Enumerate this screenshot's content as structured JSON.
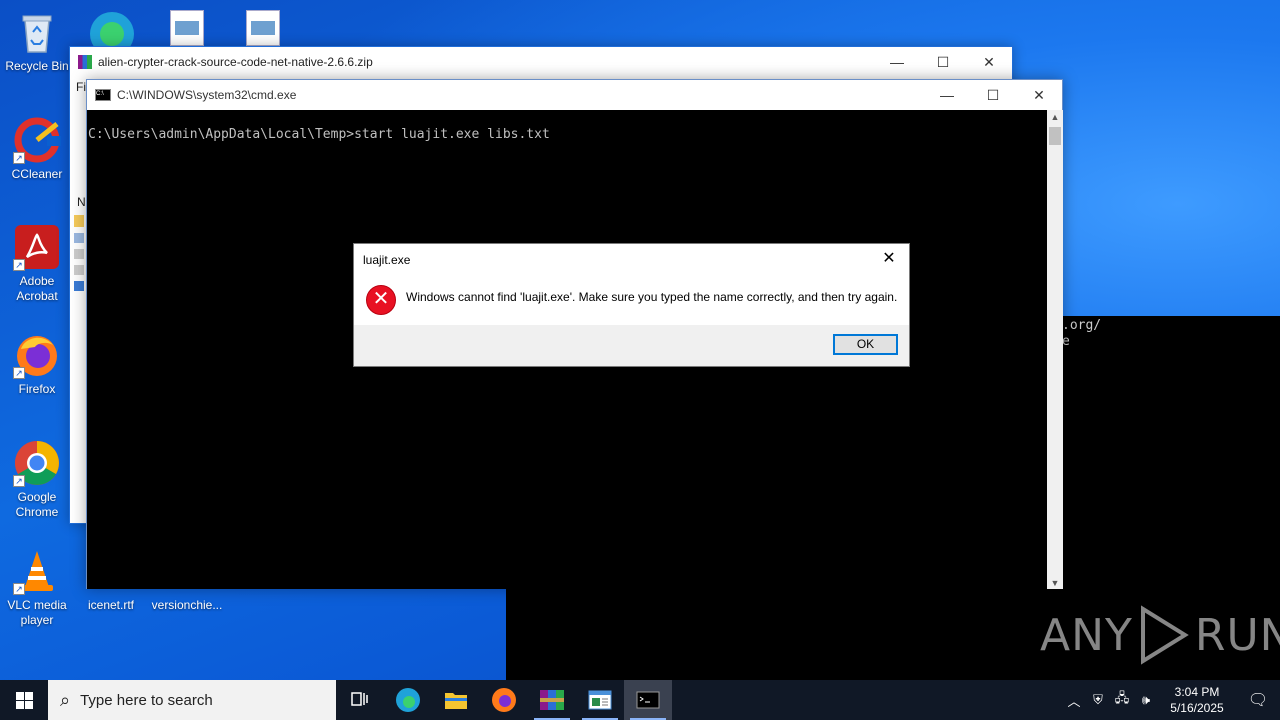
{
  "desktop": {
    "icons": [
      {
        "label": "Recycle Bin"
      },
      {
        "label": "CCleaner"
      },
      {
        "label": "Adobe Acrobat"
      },
      {
        "label": "Firefox"
      },
      {
        "label": "Google Chrome"
      },
      {
        "label": "VLC media player"
      },
      {
        "label": "icenet.rtf"
      },
      {
        "label": "versionchie..."
      }
    ]
  },
  "winrar_window": {
    "title": "alien-crypter-crack-source-code-net-native-2.6.6.zip",
    "menu_stub": "Fi",
    "col_stub": "N"
  },
  "background_console": {
    "line1": ".org/",
    "line2": "e"
  },
  "cmd_window": {
    "title": "C:\\WINDOWS\\system32\\cmd.exe",
    "prompt_line": "C:\\Users\\admin\\AppData\\Local\\Temp>start luajit.exe libs.txt"
  },
  "dialog": {
    "title": "luajit.exe",
    "message": "Windows cannot find 'luajit.exe'. Make sure you typed the name correctly, and then try again.",
    "ok_label": "OK"
  },
  "taskbar": {
    "search_placeholder": "Type here to search",
    "time": "3:04 PM",
    "date": "5/16/2025"
  },
  "watermark": {
    "left": "ANY",
    "right": "RUN"
  },
  "colors": {
    "error_red": "#e81123",
    "accent_blue": "#0078d7",
    "taskbar": "#101826"
  }
}
